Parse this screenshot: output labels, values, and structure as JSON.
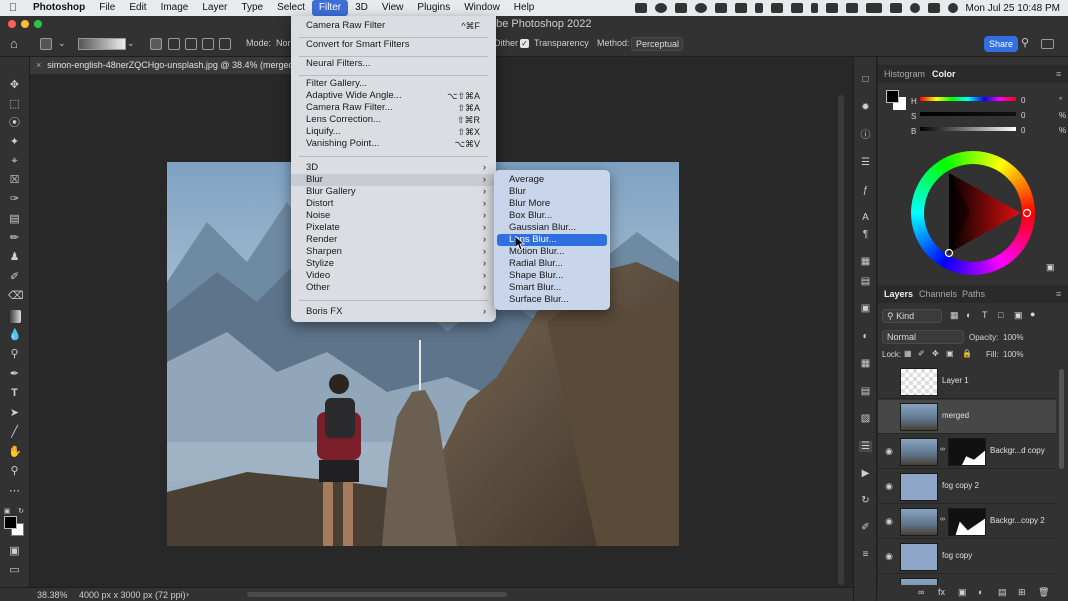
{
  "menubar": {
    "app": "Photoshop",
    "items": [
      "File",
      "Edit",
      "Image",
      "Layer",
      "Type",
      "Select",
      "Filter",
      "3D",
      "View",
      "Plugins",
      "Window",
      "Help"
    ],
    "active": "Filter",
    "clock": "Mon Jul 25  10:48 PM"
  },
  "window": {
    "title": "Adobe Photoshop 2022"
  },
  "options": {
    "mode_label": "Mode:",
    "mode_value": "Nor",
    "dither": "Dither",
    "transparency": "Transparency",
    "method_label": "Method:",
    "method_value": "Perceptual",
    "share": "Share"
  },
  "document": {
    "tab": "simon-english-48nerZQCHgo-unsplash.jpg @ 38.4% (merged, RGB/8*)",
    "zoom": "38.38%",
    "size": "4000 px x 3000 px (72 ppi)"
  },
  "filter_menu": {
    "items": [
      {
        "label": "Camera Raw Filter",
        "shortcut": "^⌘F"
      },
      {
        "label": "Convert for Smart Filters",
        "shortcut": ""
      },
      {
        "label": "Neural Filters...",
        "shortcut": ""
      },
      {
        "label": "Filter Gallery...",
        "shortcut": ""
      },
      {
        "label": "Adaptive Wide Angle...",
        "shortcut": "⌥⇧⌘A"
      },
      {
        "label": "Camera Raw Filter...",
        "shortcut": "⇧⌘A"
      },
      {
        "label": "Lens Correction...",
        "shortcut": "⇧⌘R"
      },
      {
        "label": "Liquify...",
        "shortcut": "⇧⌘X"
      },
      {
        "label": "Vanishing Point...",
        "shortcut": "⌥⌘V"
      },
      {
        "label": "3D",
        "shortcut": ""
      },
      {
        "label": "Blur",
        "shortcut": ""
      },
      {
        "label": "Blur Gallery",
        "shortcut": ""
      },
      {
        "label": "Distort",
        "shortcut": ""
      },
      {
        "label": "Noise",
        "shortcut": ""
      },
      {
        "label": "Pixelate",
        "shortcut": ""
      },
      {
        "label": "Render",
        "shortcut": ""
      },
      {
        "label": "Sharpen",
        "shortcut": ""
      },
      {
        "label": "Stylize",
        "shortcut": ""
      },
      {
        "label": "Video",
        "shortcut": ""
      },
      {
        "label": "Other",
        "shortcut": ""
      },
      {
        "label": "Boris FX",
        "shortcut": ""
      }
    ],
    "highlighted": "Blur"
  },
  "blur_menu": {
    "items": [
      "Average",
      "Blur",
      "Blur More",
      "Box Blur...",
      "Gaussian Blur...",
      "Lens Blur...",
      "Motion Blur...",
      "Radial Blur...",
      "Shape Blur...",
      "Smart Blur...",
      "Surface Blur..."
    ],
    "highlighted": "Lens Blur..."
  },
  "color_panel": {
    "tabs": [
      "Histogram",
      "Color"
    ],
    "active": "Color",
    "sliders": [
      {
        "label": "H",
        "value": "0",
        "unit": "°"
      },
      {
        "label": "S",
        "value": "0",
        "unit": "%"
      },
      {
        "label": "B",
        "value": "0",
        "unit": "%"
      }
    ]
  },
  "layers_panel": {
    "tabs": [
      "Layers",
      "Channels",
      "Paths"
    ],
    "active": "Layers",
    "filter": "Kind",
    "blend_mode": "Normal",
    "opacity_label": "Opacity:",
    "opacity": "100%",
    "lock_label": "Lock:",
    "fill_label": "Fill:",
    "fill": "100%",
    "layers": [
      {
        "name": "Layer 1",
        "visible": false,
        "selected": false,
        "mask": false
      },
      {
        "name": "merged",
        "visible": false,
        "selected": true,
        "mask": false
      },
      {
        "name": "Backgr...d copy",
        "visible": true,
        "selected": false,
        "mask": true
      },
      {
        "name": "fog copy 2",
        "visible": true,
        "selected": false,
        "mask": false
      },
      {
        "name": "Backgr...copy 2",
        "visible": true,
        "selected": false,
        "mask": true
      },
      {
        "name": "fog copy",
        "visible": true,
        "selected": false,
        "mask": false
      }
    ]
  },
  "colors": {
    "accent": "#2f6fe0",
    "panel_bg": "#323232",
    "canvas_bg": "#282828"
  }
}
